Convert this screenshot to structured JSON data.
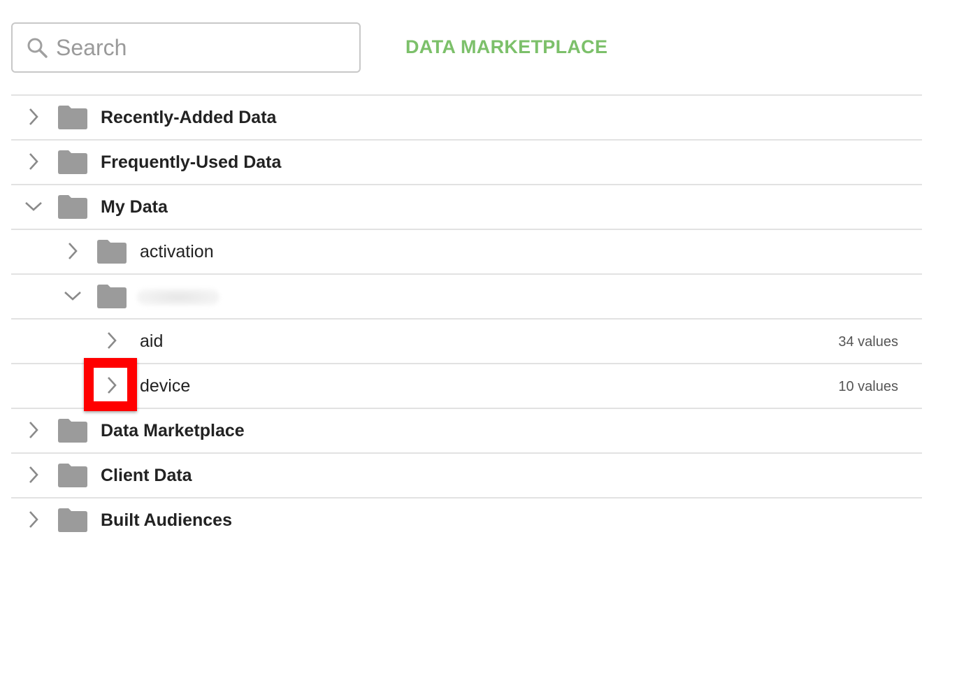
{
  "search": {
    "placeholder": "Search",
    "value": ""
  },
  "header": {
    "marketplace_link": "DATA MARKETPLACE"
  },
  "colors": {
    "accent": "#7cc06a",
    "folder": "#9b9b9b",
    "highlight": "#ff0000"
  },
  "tree": {
    "recently_added": {
      "label": "Recently-Added Data",
      "expanded": false
    },
    "frequently_used": {
      "label": "Frequently-Used Data",
      "expanded": false
    },
    "my_data": {
      "label": "My Data",
      "expanded": true,
      "children": {
        "activation": {
          "label": "activation",
          "expanded": false
        },
        "redacted_folder": {
          "label": "",
          "expanded": true,
          "redacted": true
        },
        "aid": {
          "label": "aid",
          "count": "34 values"
        },
        "device": {
          "label": "device",
          "count": "10 values"
        }
      }
    },
    "data_marketplace": {
      "label": "Data Marketplace",
      "expanded": false
    },
    "client_data": {
      "label": "Client Data",
      "expanded": false
    },
    "built_audiences": {
      "label": "Built Audiences",
      "expanded": false
    }
  }
}
